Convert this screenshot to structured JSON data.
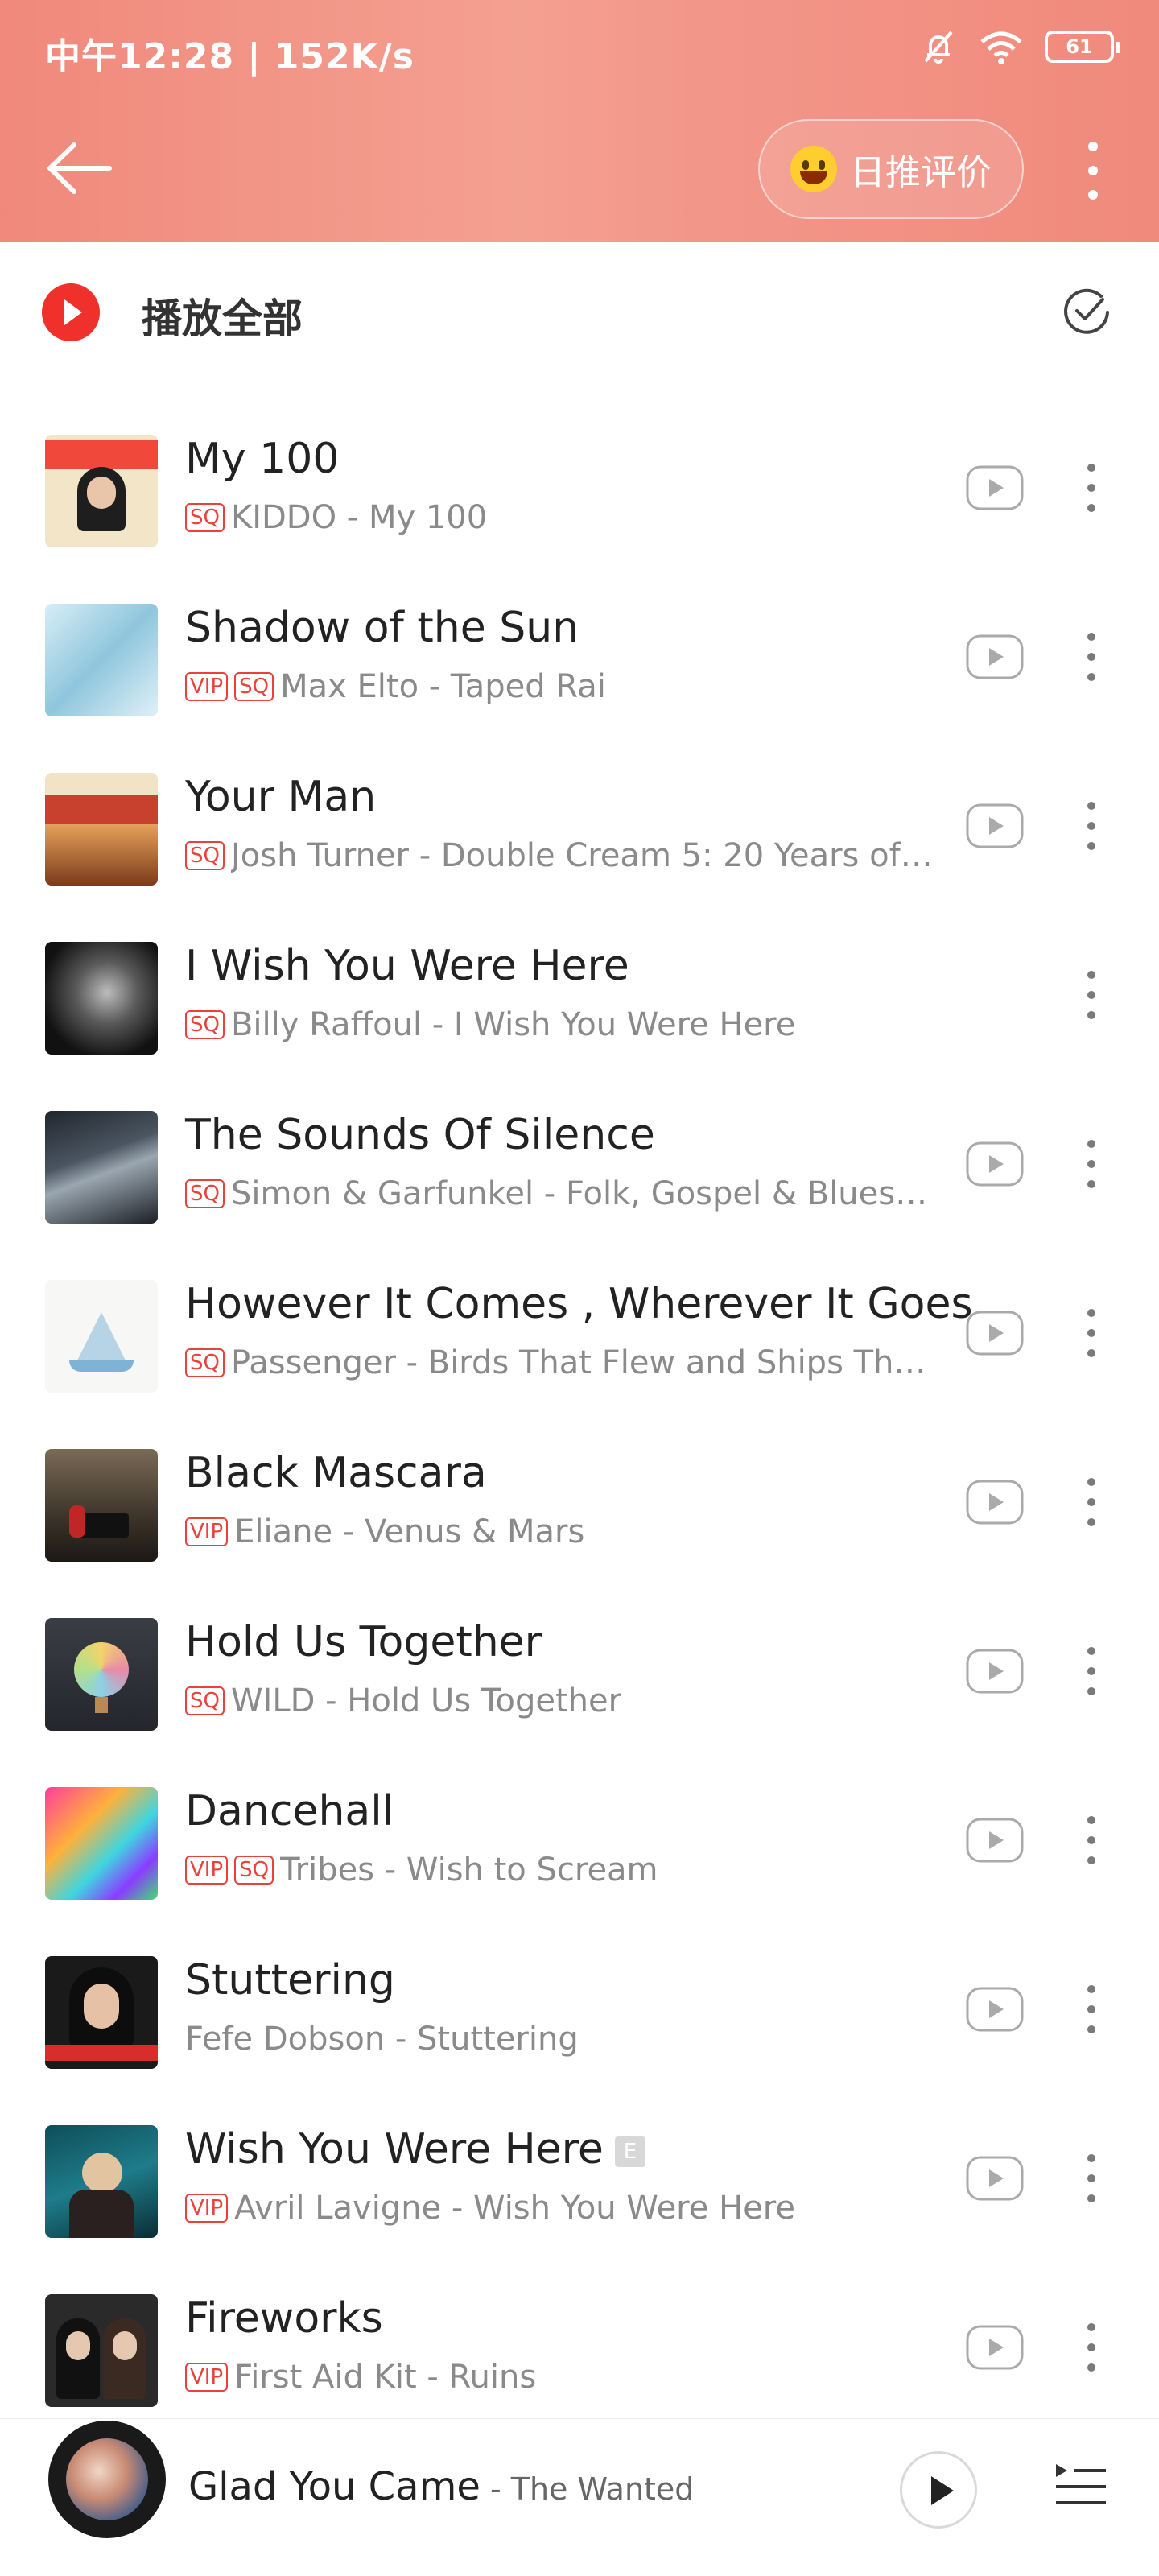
{
  "status_bar": {
    "time": "中午12:28 | 152K/s",
    "battery": "61",
    "icons": [
      "mute-bell-icon",
      "wifi-icon",
      "battery-icon"
    ]
  },
  "header": {
    "back_icon": "arrow-left-icon",
    "daily_button_label": "日推评价",
    "daily_button_icon": "smiley-emoji-icon",
    "more_icon": "kebab-icon"
  },
  "play_all": {
    "label": "播放全部",
    "play_icon": "play-circle-icon",
    "select_icon": "check-circle-icon"
  },
  "songs": [
    {
      "title": "My 100",
      "subtitle": "KIDDO - My 100",
      "badges": [
        "SQ"
      ],
      "has_mv": true
    },
    {
      "title": "Shadow of the Sun",
      "subtitle": "Max Elto - Taped Rai",
      "badges": [
        "VIP",
        "SQ"
      ],
      "has_mv": true
    },
    {
      "title": "Your Man",
      "subtitle": "Josh Turner - Double Cream 5: 20 Years of…",
      "badges": [
        "SQ"
      ],
      "has_mv": true
    },
    {
      "title": "I Wish You Were Here",
      "subtitle": "Billy Raffoul - I Wish You Were Here",
      "badges": [
        "SQ"
      ],
      "has_mv": false
    },
    {
      "title": "The Sounds Of Silence",
      "subtitle": "Simon & Garfunkel - Folk, Gospel & Blues:…",
      "badges": [
        "SQ"
      ],
      "has_mv": true
    },
    {
      "title": "However It Comes , Wherever It Goes",
      "subtitle": "Passenger - Birds That Flew and Ships Tha…",
      "badges": [
        "SQ"
      ],
      "has_mv": true
    },
    {
      "title": "Black Mascara",
      "subtitle": "Eliane - Venus & Mars",
      "badges": [
        "VIP"
      ],
      "has_mv": true
    },
    {
      "title": "Hold Us Together",
      "subtitle": "WILD - Hold Us Together",
      "badges": [
        "SQ"
      ],
      "has_mv": true
    },
    {
      "title": "Dancehall",
      "subtitle": "Tribes - Wish to Scream",
      "badges": [
        "VIP",
        "SQ"
      ],
      "has_mv": true
    },
    {
      "title": "Stuttering",
      "subtitle": "Fefe Dobson - Stuttering",
      "badges": [],
      "has_mv": true
    },
    {
      "title": "Wish You Were Here",
      "subtitle": "Avril Lavigne - Wish You Were Here",
      "badges": [
        "VIP"
      ],
      "has_mv": true,
      "explicit": "E"
    },
    {
      "title": "Fireworks",
      "subtitle": "First Aid Kit - Ruins",
      "badges": [
        "VIP"
      ],
      "has_mv": true
    }
  ],
  "player": {
    "title": "Glad You Came",
    "artist": " - The Wanted",
    "play_icon": "play-icon",
    "playlist_icon": "playlist-icon"
  },
  "colors": {
    "header": "#f3968a",
    "accent_red": "#f0302a",
    "badge_red": "#e8423a",
    "subtitle_gray": "#8a8a8a"
  }
}
